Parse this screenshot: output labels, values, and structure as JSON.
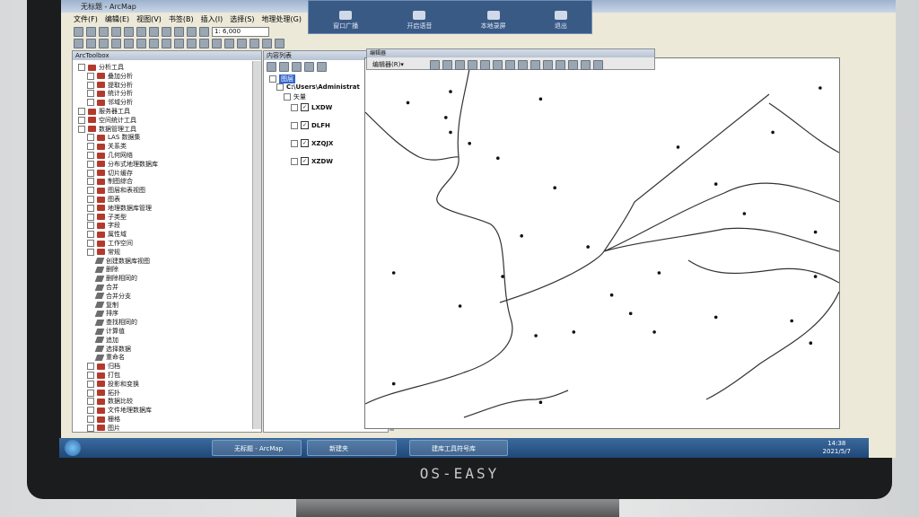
{
  "app": {
    "title": "无标题 - ArcMap"
  },
  "menu": [
    "文件(F)",
    "编辑(E)",
    "视图(V)",
    "书签(B)",
    "插入(I)",
    "选择(S)",
    "地理处理(G)"
  ],
  "toolbar": {
    "scale": "1: 6,000"
  },
  "media_bar": [
    "窗口广播",
    "开启语音",
    "本地录屏",
    "退出"
  ],
  "arctoolbox": {
    "header": "ArcToolbox",
    "items": [
      {
        "label": "分析工具",
        "indent": 0,
        "kind": "toolbox"
      },
      {
        "label": "叠加分析",
        "indent": 1,
        "kind": "toolbox"
      },
      {
        "label": "提取分析",
        "indent": 1,
        "kind": "toolbox"
      },
      {
        "label": "统计分析",
        "indent": 1,
        "kind": "toolbox"
      },
      {
        "label": "邻域分析",
        "indent": 1,
        "kind": "toolbox"
      },
      {
        "label": "服务器工具",
        "indent": 0,
        "kind": "toolbox"
      },
      {
        "label": "空间统计工具",
        "indent": 0,
        "kind": "toolbox"
      },
      {
        "label": "数据管理工具",
        "indent": 0,
        "kind": "toolbox"
      },
      {
        "label": "LAS 数据集",
        "indent": 1,
        "kind": "toolbox"
      },
      {
        "label": "关系类",
        "indent": 1,
        "kind": "toolbox"
      },
      {
        "label": "几何网络",
        "indent": 1,
        "kind": "toolbox"
      },
      {
        "label": "分布式地理数据库",
        "indent": 1,
        "kind": "toolbox"
      },
      {
        "label": "切片缓存",
        "indent": 1,
        "kind": "toolbox"
      },
      {
        "label": "制图综合",
        "indent": 1,
        "kind": "toolbox"
      },
      {
        "label": "图层和表视图",
        "indent": 1,
        "kind": "toolbox"
      },
      {
        "label": "图表",
        "indent": 1,
        "kind": "toolbox"
      },
      {
        "label": "地理数据库管理",
        "indent": 1,
        "kind": "toolbox"
      },
      {
        "label": "子类型",
        "indent": 1,
        "kind": "toolbox"
      },
      {
        "label": "字段",
        "indent": 1,
        "kind": "toolbox"
      },
      {
        "label": "属性域",
        "indent": 1,
        "kind": "toolbox"
      },
      {
        "label": "工作空间",
        "indent": 1,
        "kind": "toolbox"
      },
      {
        "label": "常规",
        "indent": 1,
        "kind": "toolbox"
      },
      {
        "label": "创建数据库视图",
        "indent": 2,
        "kind": "tool"
      },
      {
        "label": "删除",
        "indent": 2,
        "kind": "tool"
      },
      {
        "label": "删除相同的",
        "indent": 2,
        "kind": "tool"
      },
      {
        "label": "合并",
        "indent": 2,
        "kind": "tool"
      },
      {
        "label": "合并分支",
        "indent": 2,
        "kind": "tool"
      },
      {
        "label": "复制",
        "indent": 2,
        "kind": "tool"
      },
      {
        "label": "排序",
        "indent": 2,
        "kind": "tool"
      },
      {
        "label": "查找相同的",
        "indent": 2,
        "kind": "tool"
      },
      {
        "label": "计算值",
        "indent": 2,
        "kind": "tool"
      },
      {
        "label": "追加",
        "indent": 2,
        "kind": "tool"
      },
      {
        "label": "选择数据",
        "indent": 2,
        "kind": "tool"
      },
      {
        "label": "重命名",
        "indent": 2,
        "kind": "tool"
      },
      {
        "label": "归档",
        "indent": 1,
        "kind": "toolbox"
      },
      {
        "label": "打包",
        "indent": 1,
        "kind": "toolbox"
      },
      {
        "label": "投影和变换",
        "indent": 1,
        "kind": "toolbox"
      },
      {
        "label": "拓扑",
        "indent": 1,
        "kind": "toolbox"
      },
      {
        "label": "数据比较",
        "indent": 1,
        "kind": "toolbox"
      },
      {
        "label": "文件地理数据库",
        "indent": 1,
        "kind": "toolbox"
      },
      {
        "label": "栅格",
        "indent": 1,
        "kind": "toolbox"
      },
      {
        "label": "图片",
        "indent": 1,
        "kind": "toolbox"
      }
    ]
  },
  "toc": {
    "header": "内容列表",
    "layers_root": "图层",
    "path": "C:\\Users\\Administrat",
    "group": "矢量",
    "layers": [
      "LXDW",
      "DLFH",
      "XZQJX",
      "XZDW"
    ]
  },
  "editor": {
    "header": "编辑器",
    "label": "编辑器(R)▾"
  },
  "taskbar": {
    "tasks": [
      "无标题 - ArcMap",
      "新建夹",
      "建库工具符号库"
    ],
    "time": "14:38",
    "date": "2021/5/7"
  },
  "brand": "OS-EASY",
  "map": {
    "points": [
      [
        0.09,
        0.12
      ],
      [
        0.18,
        0.09
      ],
      [
        0.37,
        0.11
      ],
      [
        0.96,
        0.08
      ],
      [
        0.17,
        0.16
      ],
      [
        0.18,
        0.2
      ],
      [
        0.22,
        0.23
      ],
      [
        0.28,
        0.27
      ],
      [
        0.66,
        0.24
      ],
      [
        0.86,
        0.2
      ],
      [
        0.4,
        0.35
      ],
      [
        0.74,
        0.34
      ],
      [
        0.8,
        0.42
      ],
      [
        0.95,
        0.47
      ],
      [
        0.33,
        0.48
      ],
      [
        0.47,
        0.51
      ],
      [
        0.06,
        0.58
      ],
      [
        0.29,
        0.59
      ],
      [
        0.62,
        0.58
      ],
      [
        0.95,
        0.59
      ],
      [
        0.52,
        0.64
      ],
      [
        0.2,
        0.67
      ],
      [
        0.56,
        0.69
      ],
      [
        0.74,
        0.7
      ],
      [
        0.9,
        0.71
      ],
      [
        0.36,
        0.75
      ],
      [
        0.44,
        0.74
      ],
      [
        0.61,
        0.74
      ],
      [
        0.94,
        0.77
      ],
      [
        0.06,
        0.88
      ],
      [
        0.37,
        0.93
      ]
    ],
    "colors": {
      "line": "#333333",
      "point": "#111111"
    }
  }
}
